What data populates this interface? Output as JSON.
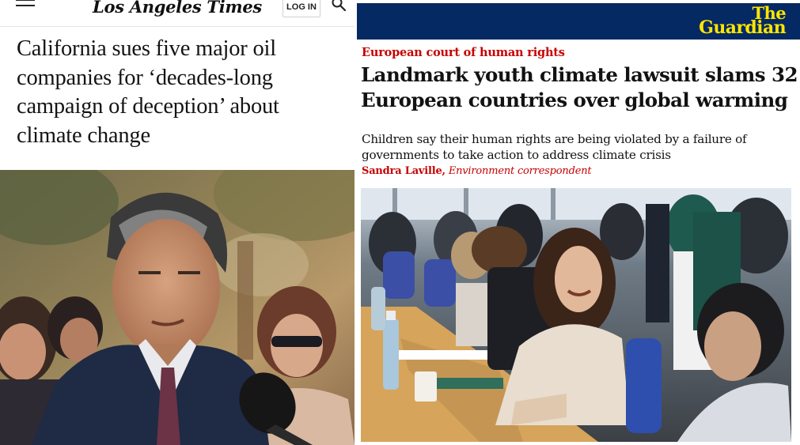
{
  "latimes": {
    "logo": "Los Angeles Times",
    "login_label": "LOG IN",
    "menu_icon": "hamburger-menu-icon",
    "search_icon": "search-icon",
    "headline": "California sues five major oil companies for ‘decades-long campaign of deception’ about climate change"
  },
  "guardian": {
    "logo_line1": "The",
    "logo_line2": "Guardian",
    "section": "European court of human rights",
    "headline": "Landmark youth climate lawsuit slams 32 European countries over global warming",
    "standfirst": "Children say their human rights are being violated by a failure of governments to take action to address climate crisis",
    "byline_author": "Sandra Laville,",
    "byline_role": "Environment correspondent"
  },
  "colors": {
    "guardian_navy": "#052962",
    "guardian_yellow": "#ffe500",
    "guardian_red": "#c70000",
    "latimes_text": "#141414"
  }
}
